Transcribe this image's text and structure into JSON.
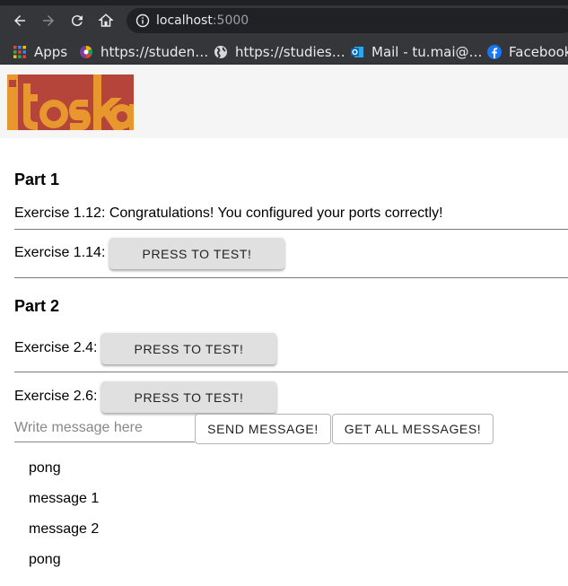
{
  "browser": {
    "url_host": "localhost",
    "url_port": ":5000",
    "bookmarks": [
      {
        "label": "Apps",
        "icon": "apps-grid-icon"
      },
      {
        "label": "https://studen…",
        "icon": "colorful-wheel-icon"
      },
      {
        "label": "https://studies…",
        "icon": "globe-icon"
      },
      {
        "label": "Mail - tu.mai@…",
        "icon": "outlook-icon"
      },
      {
        "label": "Facebook",
        "icon": "facebook-icon"
      }
    ]
  },
  "header": {
    "logo_text": "itoska",
    "logo_colors": {
      "orange": "#e8962e",
      "red": "#b5453a"
    }
  },
  "part1": {
    "title": "Part 1",
    "ex112": "Exercise 1.12: Congratulations! You configured your ports correctly!",
    "ex114_label": "Exercise 1.14:",
    "ex114_button": "PRESS TO TEST!"
  },
  "part2": {
    "title": "Part 2",
    "ex24_label": "Exercise 2.4:",
    "ex24_button": "PRESS TO TEST!",
    "ex26_label": "Exercise 2.6:",
    "ex26_button": "PRESS TO TEST!",
    "message_placeholder": "Write message here",
    "send_button": "SEND MESSAGE!",
    "get_all_button": "GET ALL MESSAGES!",
    "messages": [
      "pong",
      "message 1",
      "message 2",
      "pong"
    ]
  }
}
